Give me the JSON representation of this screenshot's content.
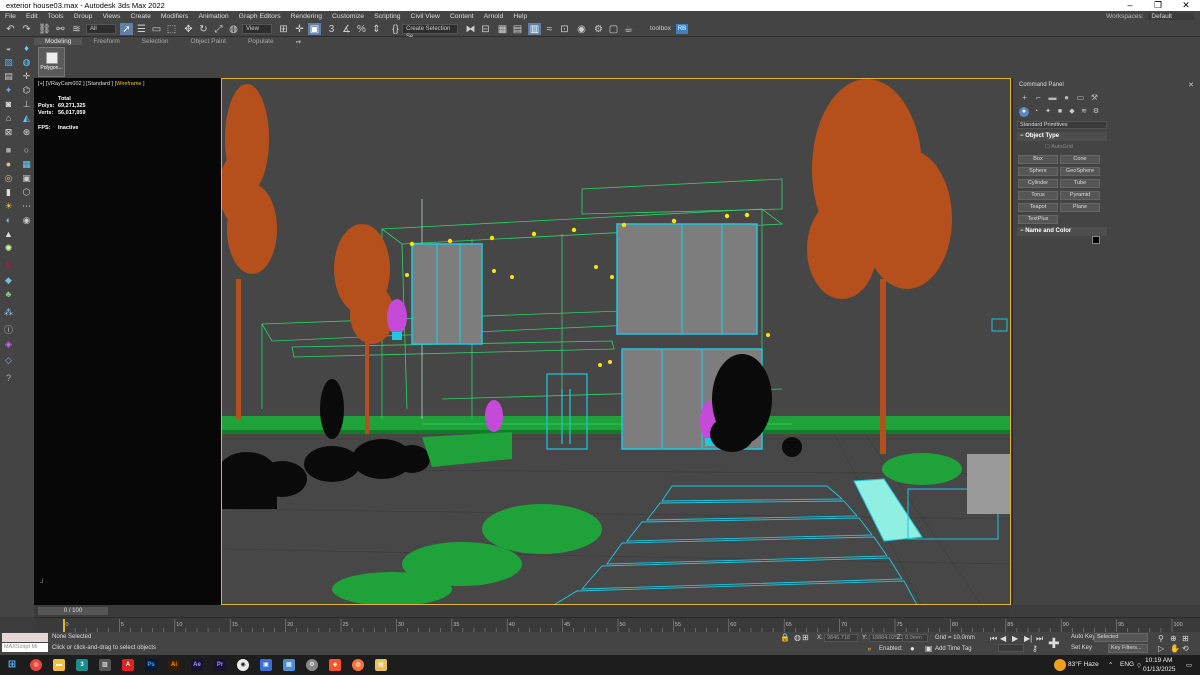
{
  "window": {
    "title": "exterior house03.max - Autodesk 3ds Max 2022",
    "controls": [
      "–",
      "❐",
      "✕"
    ]
  },
  "menu": {
    "items": [
      "File",
      "Edit",
      "Tools",
      "Group",
      "Views",
      "Create",
      "Modifiers",
      "Animation",
      "Graph Editors",
      "Rendering",
      "Customize",
      "Scripting",
      "Civil View",
      "Content",
      "Arnold",
      "Help"
    ],
    "workspaces_label": "Workspaces:",
    "workspaces_value": "Default"
  },
  "toolbar": {
    "filter": "All",
    "refcoord": "View",
    "selection_set": "Create Selection Se",
    "toolbox": "toolbox",
    "rb": "RB"
  },
  "ribbon": {
    "tabs": [
      "Modeling",
      "Freeform",
      "Selection",
      "Object Paint",
      "Populate"
    ],
    "panel_label": "Polygon..."
  },
  "viewport": {
    "label_prefix": "[+] [VRayCam002 ] [Standard ]",
    "label_mode": "[Wireframe ]",
    "stats": {
      "total_label": "Total",
      "polys_label": "Polys:",
      "polys_value": "69,271,325",
      "verts_label": "Verts:",
      "verts_value": "56,017,059",
      "fps_label": "FPS:",
      "fps_value": "Inactive"
    }
  },
  "command_panel": {
    "title": "Command Panel",
    "close": "✕",
    "category": "Standard Primitives",
    "object_type_title": "Object Type",
    "autogrid": "AutoGrid",
    "buttons": [
      "Box",
      "Cone",
      "Sphere",
      "GeoSphere",
      "Cylinder",
      "Tube",
      "Torus",
      "Pyramid",
      "Teapot",
      "Plane",
      "TextPlus"
    ],
    "name_color_title": "Name and Color"
  },
  "timeline": {
    "frame": "0 / 100",
    "ticks": [
      "0",
      "5",
      "10",
      "15",
      "20",
      "25",
      "30",
      "35",
      "40",
      "45",
      "50",
      "55",
      "60",
      "65",
      "70",
      "75",
      "80",
      "85",
      "90",
      "95",
      "100"
    ]
  },
  "status": {
    "maxscript": "MAXScript Mi",
    "none_selected": "None Selected",
    "prompt": "Click or click-and-drag to select objects",
    "x_label": "X:",
    "x_value": "9846.718",
    "y_label": "Y:",
    "y_value": "18884.025",
    "z_label": "Z:",
    "z_value": "0.0mm",
    "grid": "Grid = 10.0mm",
    "enabled": "Enabled:",
    "add_time_tag": "Add Time Tag",
    "auto_key": "Auto Key",
    "set_key": "Set Key",
    "selected": "Selected",
    "key_filters": "Key Filters..."
  },
  "taskbar": {
    "weather": "83°F  Haze",
    "lang": "ENG",
    "time": "10:19 AM",
    "date": "01/13/2025"
  },
  "colors": {
    "accent": "#5b86c6",
    "viewport_border": "#e0b23a",
    "tree": "#b5501d",
    "foliage": "#22a83c",
    "frame": "#1fc7e0"
  }
}
